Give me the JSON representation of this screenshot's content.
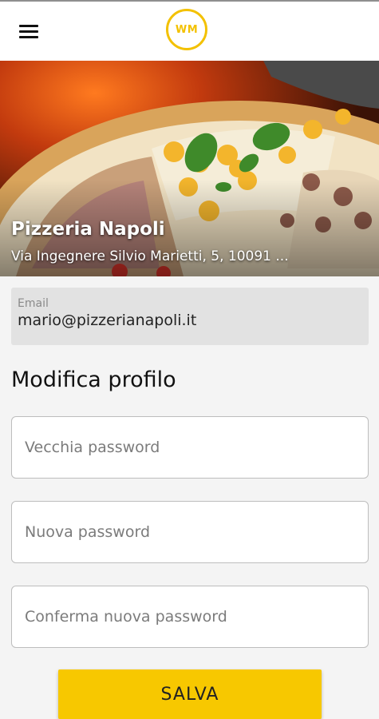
{
  "header": {
    "logo_text": "WM",
    "menu_icon": "hamburger-menu-icon",
    "accent_color": "#f3c100"
  },
  "hero": {
    "restaurant_name": "Pizzeria Napoli",
    "address": "Via Ingegnere Silvio Marietti, 5, 10091 ..."
  },
  "account": {
    "email_label": "Email",
    "email_value": "mario@pizzerianapoli.it"
  },
  "form": {
    "title": "Modifica profilo",
    "old_password_placeholder": "Vecchia password",
    "new_password_placeholder": "Nuova password",
    "confirm_password_placeholder": "Conferma nuova password",
    "save_label": "SALVA",
    "button_color": "#f7c800"
  }
}
